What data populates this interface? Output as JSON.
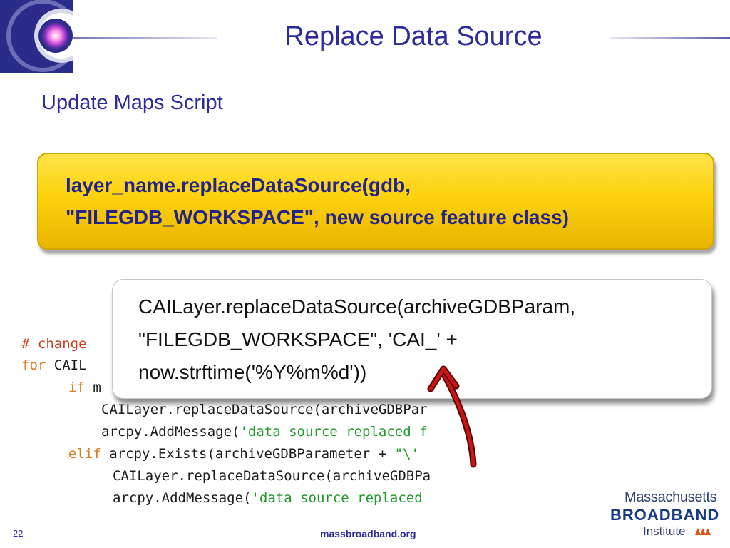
{
  "slide": {
    "title": "Replace Data Source",
    "subtitle": "Update Maps Script",
    "page_number": "22",
    "footer_site": "massbroadband.org"
  },
  "syntax_box": {
    "line1": "layer_name.replaceDataSource(gdb,",
    "line2": "\"FILEGDB_WORKSPACE\", new source feature class)"
  },
  "example_box": {
    "line1": "CAILayer.replaceDataSource(archiveGDBParam,",
    "line2": "\"FILEGDB_WORKSPACE\", 'CAI_' +",
    "line3": "now.strftime('%Y%m%d'))"
  },
  "code_snippet": {
    "line1_comment": "# change",
    "line2_kw": "for",
    "line2_rest": " CAIL",
    "line3_kw": "if",
    "line3_rest": " m",
    "line4": "CAILayer.replaceDataSource(archiveGDBPar",
    "line5_a": "arcpy.AddMessage(",
    "line5_str": "'data source replaced f",
    "line6_kw": "elif",
    "line6_rest": " arcpy.Exists(archiveGDBParameter + ",
    "line6_str": "\"\\'",
    "line7": "CAILayer.replaceDataSource(archiveGDBPa",
    "line8_a": "arcpy.AddMessage(",
    "line8_str": "'data source replaced "
  },
  "organization": {
    "line1": "Massachusetts",
    "line2": "BROADBAND",
    "line3": "Institute"
  },
  "colors": {
    "title_blue": "#2b2b9c",
    "highlight_yellow": "#fcd20c",
    "arrow_red": "#b01010",
    "keyword_orange": "#e07a1a",
    "string_green": "#1f9a2a"
  }
}
